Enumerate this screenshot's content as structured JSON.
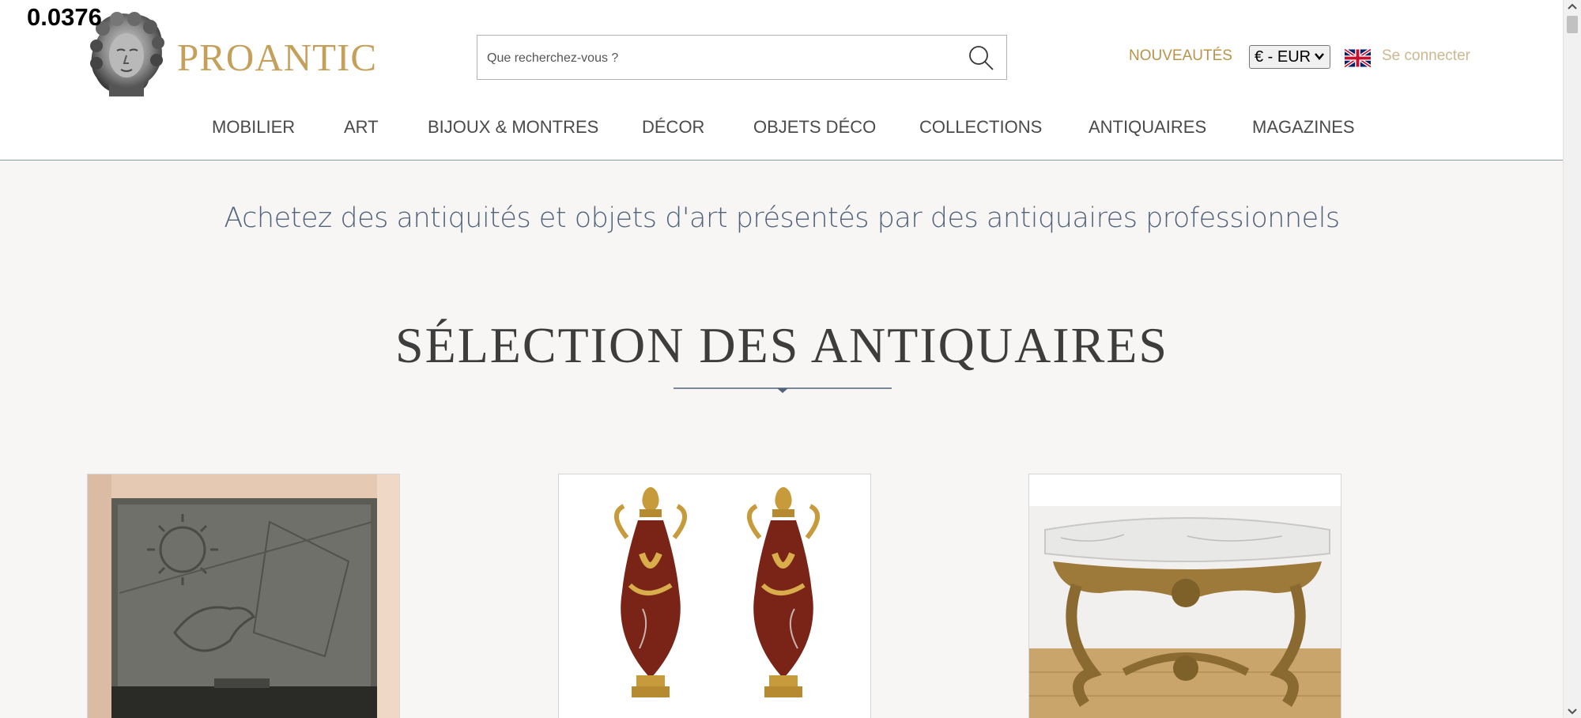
{
  "counter": "0.0376",
  "brand": {
    "name": "PROANTIC",
    "color": "#c5a05a"
  },
  "search": {
    "placeholder": "Que recherchez-vous ?"
  },
  "header": {
    "nouveautes": "NOUVEAUTÉS",
    "currency": "€ - EUR",
    "login": "Se connecter"
  },
  "nav": [
    {
      "label": "MOBILIER"
    },
    {
      "label": "ART"
    },
    {
      "label": "BIJOUX & MONTRES"
    },
    {
      "label": "DÉCOR"
    },
    {
      "label": "OBJETS DÉCO"
    },
    {
      "label": "COLLECTIONS"
    },
    {
      "label": "ANTIQUAIRES"
    },
    {
      "label": "MAGAZINES"
    }
  ],
  "tagline": "Achetez des antiquités et objets d'art présentés par des antiquaires professionnels",
  "section": {
    "title": "SÉLECTION DES ANTIQUAIRES"
  },
  "products": [
    {
      "icon": "art-deco-fireplace-image"
    },
    {
      "icon": "marble-vases-pair-image"
    },
    {
      "icon": "gilded-console-table-image"
    }
  ],
  "colors": {
    "accent": "#c5a05a",
    "text_blue": "#52647c",
    "background": "#f7f6f4"
  }
}
